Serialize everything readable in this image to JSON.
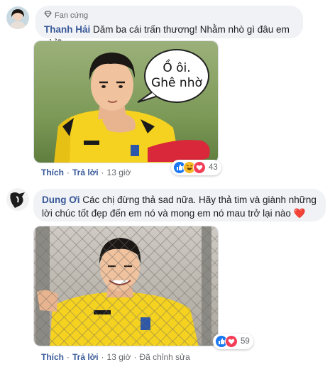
{
  "comment1": {
    "badge": "Fan cứng",
    "name": "Thanh Hải",
    "text": "Dăm ba cái trấn thương! Nhằm nhò gì đâu em nhỉ?",
    "speech_line1": "Ồ ôi.",
    "speech_line2": "Ghê nhờ",
    "actions": {
      "like": "Thích",
      "reply": "Trả lời",
      "time": "13 giờ"
    },
    "reactions": {
      "icons": [
        "like-reaction",
        "haha-reaction",
        "love-reaction"
      ],
      "count": "43"
    }
  },
  "comment2": {
    "name": "Dung Ơi",
    "text": "Các chị đừng thả sad nữa. Hãy thả tim và giành những lời chúc tốt đẹp đến em nó và mong em nó mau trở lại nào",
    "emoji": "❤️",
    "actions": {
      "like": "Thích",
      "reply": "Trả lời",
      "time": "13 giờ",
      "edited": "Đã chỉnh sửa"
    },
    "reactions": {
      "icons": [
        "like-reaction",
        "love-reaction"
      ],
      "count": "59"
    }
  },
  "colors": {
    "name_blue": "#385898",
    "bubble_bg": "#f0f2f5",
    "meta_gray": "#65676b",
    "jersey_yellow": "#f5d21f",
    "sleeve_red": "#d9283a"
  }
}
